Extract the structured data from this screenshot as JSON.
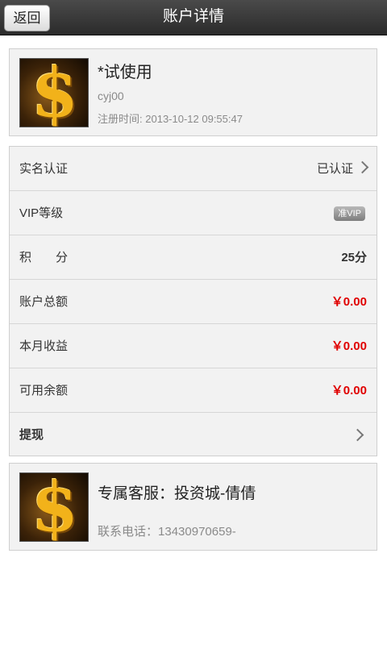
{
  "header": {
    "back_label": "返回",
    "title": "账户详情"
  },
  "profile": {
    "name": "*试使用",
    "username": "cyj00",
    "register_label": "注册时间:",
    "register_time": "2013-10-12 09:55:47",
    "avatar_icon": "gold-dollar-sign-icon"
  },
  "rows": {
    "realname": {
      "label": "实名认证",
      "value": "已认证"
    },
    "vip": {
      "label": "VIP等级",
      "badge": "准VIP"
    },
    "points": {
      "label": "积　　分",
      "value": "25分"
    },
    "total": {
      "label": "账户总额",
      "value": "￥0.00"
    },
    "monthly": {
      "label": "本月收益",
      "value": "￥0.00"
    },
    "available": {
      "label": "可用余额",
      "value": "￥0.00"
    },
    "withdraw": {
      "label": "提现"
    }
  },
  "service": {
    "title": "专属客服：投资城-倩倩",
    "phone_label": "联系电话：",
    "phone": "13430970659-",
    "avatar_icon": "gold-dollar-sign-icon"
  },
  "colors": {
    "accent_red": "#e00000",
    "titlebar": "#333333"
  }
}
